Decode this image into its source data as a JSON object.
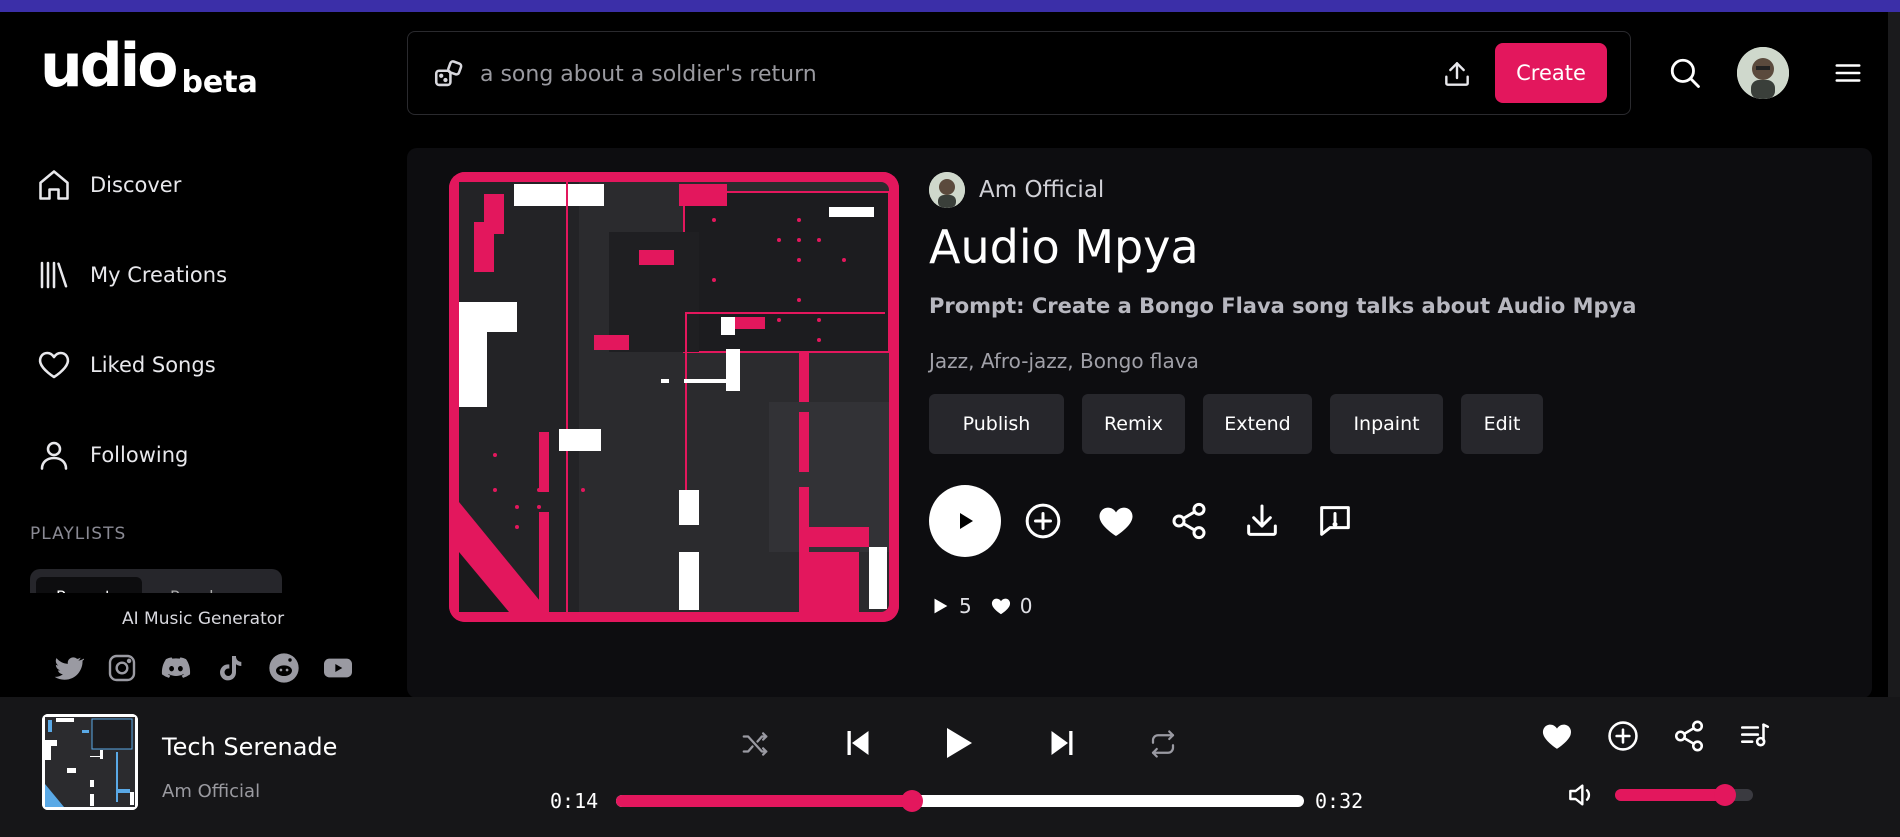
{
  "brand": {
    "logo": "udio",
    "badge": "beta"
  },
  "prompt_bar": {
    "placeholder": "a song about a soldier's return",
    "create_label": "Create"
  },
  "sidebar": {
    "items": [
      {
        "label": "Discover",
        "icon": "home-icon"
      },
      {
        "label": "My Creations",
        "icon": "library-icon"
      },
      {
        "label": "Liked Songs",
        "icon": "heart-icon"
      },
      {
        "label": "Following",
        "icon": "user-icon"
      }
    ],
    "playlists_heading": "PLAYLISTS",
    "playlist_tabs": [
      "Recents",
      "Popular"
    ],
    "footer_label": "AI Music Generator",
    "social": [
      "twitter-icon",
      "instagram-icon",
      "discord-icon",
      "tiktok-icon",
      "reddit-icon",
      "youtube-icon"
    ]
  },
  "song": {
    "author": "Am Official",
    "title": "Audio Mpya",
    "prompt": "Prompt: Create a Bongo Flava song talks about Audio Mpya",
    "tags": "Jazz, Afro-jazz, Bongo flava",
    "actions": [
      "Publish",
      "Remix",
      "Extend",
      "Inpaint",
      "Edit"
    ],
    "plays": "5",
    "likes": "0"
  },
  "player": {
    "title": "Tech Serenade",
    "artist": "Am Official",
    "current_time": "0:14",
    "total_time": "0:32",
    "progress": 0.43,
    "volume": 0.8
  },
  "colors": {
    "accent": "#e3175d",
    "background": "#000000",
    "panel": "#0d0d10",
    "topbar": "#3b2fa8"
  }
}
